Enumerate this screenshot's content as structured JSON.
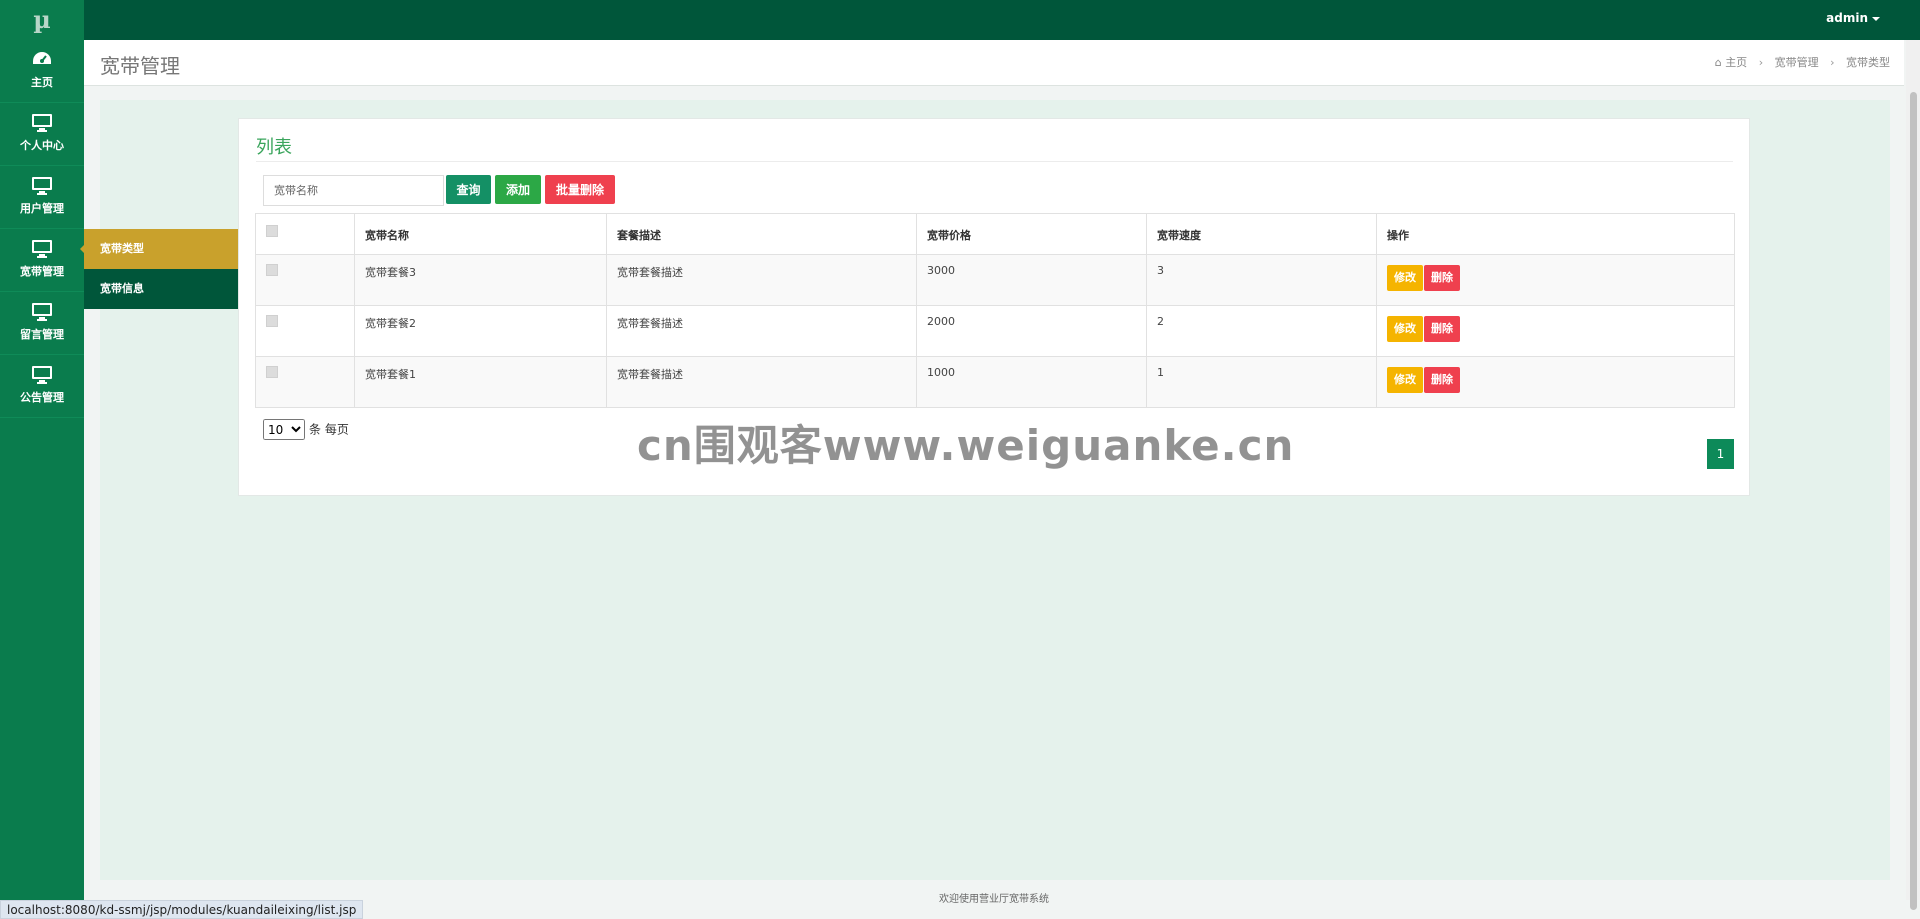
{
  "app": {
    "logo": "µ"
  },
  "topbar": {
    "user": "admin"
  },
  "sidebar": {
    "items": [
      {
        "label": "主页",
        "icon": "dashboard-icon"
      },
      {
        "label": "个人中心",
        "icon": "monitor-icon"
      },
      {
        "label": "用户管理",
        "icon": "monitor-icon"
      },
      {
        "label": "宽带管理",
        "icon": "monitor-icon"
      },
      {
        "label": "留言管理",
        "icon": "monitor-icon"
      },
      {
        "label": "公告管理",
        "icon": "monitor-icon"
      }
    ]
  },
  "submenu": {
    "items": [
      {
        "label": "宽带类型",
        "active": true
      },
      {
        "label": "宽带信息",
        "active": false
      }
    ]
  },
  "header": {
    "title": "宽带管理",
    "breadcrumb": [
      "主页",
      "宽带管理",
      "宽带类型"
    ]
  },
  "panel": {
    "title": "列表",
    "search": {
      "placeholder": "宽带名称",
      "value": ""
    },
    "buttons": {
      "query": "查询",
      "add": "添加",
      "batch_delete": "批量删除"
    }
  },
  "table": {
    "columns": [
      "",
      "宽带名称",
      "套餐描述",
      "宽带价格",
      "宽带速度",
      "操作"
    ],
    "rows": [
      {
        "name": "宽带套餐3",
        "desc": "宽带套餐描述",
        "price": "3000",
        "speed": "3",
        "edit": "修改",
        "delete": "删除"
      },
      {
        "name": "宽带套餐2",
        "desc": "宽带套餐描述",
        "price": "2000",
        "speed": "2",
        "edit": "修改",
        "delete": "删除"
      },
      {
        "name": "宽带套餐1",
        "desc": "宽带套餐描述",
        "price": "1000",
        "speed": "1",
        "edit": "修改",
        "delete": "删除"
      }
    ]
  },
  "pagination": {
    "page_size": "10",
    "page_size_suffix": "条 每页",
    "current_page": "1"
  },
  "watermark": "cn围观客www.weiguanke.cn",
  "footer": {
    "text": "欢迎使用营业厅宽带系统"
  },
  "status_bar": {
    "url": "localhost:8080/kd-ssmj/jsp/modules/kuandaileixing/list.jsp"
  },
  "colors": {
    "primary": "#0a7c4d",
    "topbar": "#00563a",
    "active_submenu": "#c9a12c",
    "danger": "#ef404e",
    "warning": "#f5b400",
    "success": "#2ca846"
  }
}
